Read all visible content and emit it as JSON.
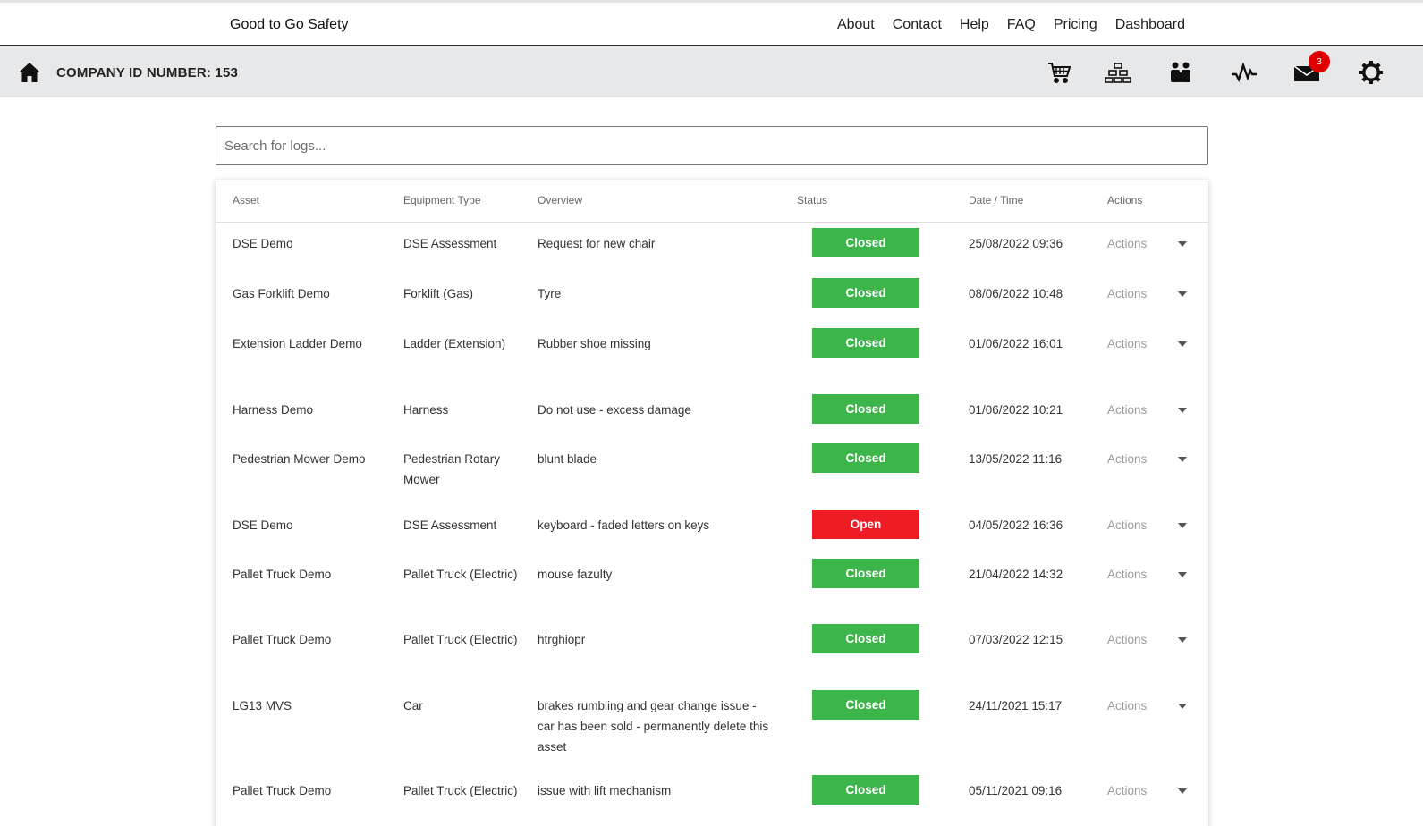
{
  "header": {
    "brand": "Good to Go Safety",
    "nav": [
      "About",
      "Contact",
      "Help",
      "FAQ",
      "Pricing",
      "Dashboard"
    ]
  },
  "subbar": {
    "company_label": "COMPANY ID NUMBER: 153",
    "icons": [
      "cart-icon",
      "network-icon",
      "users-icon",
      "activity-icon",
      "mail-icon",
      "settings-icon"
    ],
    "mail_badge": "3"
  },
  "search": {
    "placeholder": "Search for logs..."
  },
  "table": {
    "headers": [
      "Asset",
      "Equipment Type",
      "Overview",
      "Status",
      "Date / Time",
      "Actions"
    ],
    "action_label": "Actions",
    "status_colors": {
      "Closed": "#3cb54a",
      "Open": "#ee1c25"
    },
    "rows": [
      {
        "asset": "DSE Demo",
        "equipment": "DSE Assessment",
        "overview": "Request for new chair",
        "status": "Closed",
        "datetime": "25/08/2022 09:36"
      },
      {
        "asset": "Gas Forklift Demo",
        "equipment": "Forklift (Gas)",
        "overview": "Tyre",
        "status": "Closed",
        "datetime": "08/06/2022 10:48"
      },
      {
        "asset": "Extension Ladder Demo",
        "equipment": "Ladder (Extension)",
        "overview": "Rubber shoe missing",
        "status": "Closed",
        "datetime": "01/06/2022 16:01"
      },
      {
        "asset": "Harness Demo",
        "equipment": "Harness",
        "overview": "Do not use - excess damage",
        "status": "Closed",
        "datetime": "01/06/2022 10:21"
      },
      {
        "asset": "Pedestrian Mower Demo",
        "equipment": "Pedestrian Rotary Mower",
        "overview": "blunt blade",
        "status": "Closed",
        "datetime": "13/05/2022 11:16"
      },
      {
        "asset": "DSE Demo",
        "equipment": "DSE Assessment",
        "overview": "keyboard - faded letters on keys",
        "status": "Open",
        "datetime": "04/05/2022 16:36"
      },
      {
        "asset": "Pallet Truck Demo",
        "equipment": "Pallet Truck (Electric)",
        "overview": "mouse fazulty",
        "status": "Closed",
        "datetime": "21/04/2022 14:32"
      },
      {
        "asset": "Pallet Truck Demo",
        "equipment": "Pallet Truck (Electric)",
        "overview": "htrghiopr",
        "status": "Closed",
        "datetime": "07/03/2022 12:15"
      },
      {
        "asset": "LG13 MVS",
        "equipment": "Car",
        "overview": "brakes rumbling and gear change issue - car has been sold - permanently delete this asset",
        "status": "Closed",
        "datetime": "24/11/2021 15:17"
      },
      {
        "asset": "Pallet Truck Demo",
        "equipment": "Pallet Truck (Electric)",
        "overview": "issue with lift mechanism",
        "status": "Closed",
        "datetime": "05/11/2021 09:16"
      }
    ]
  }
}
